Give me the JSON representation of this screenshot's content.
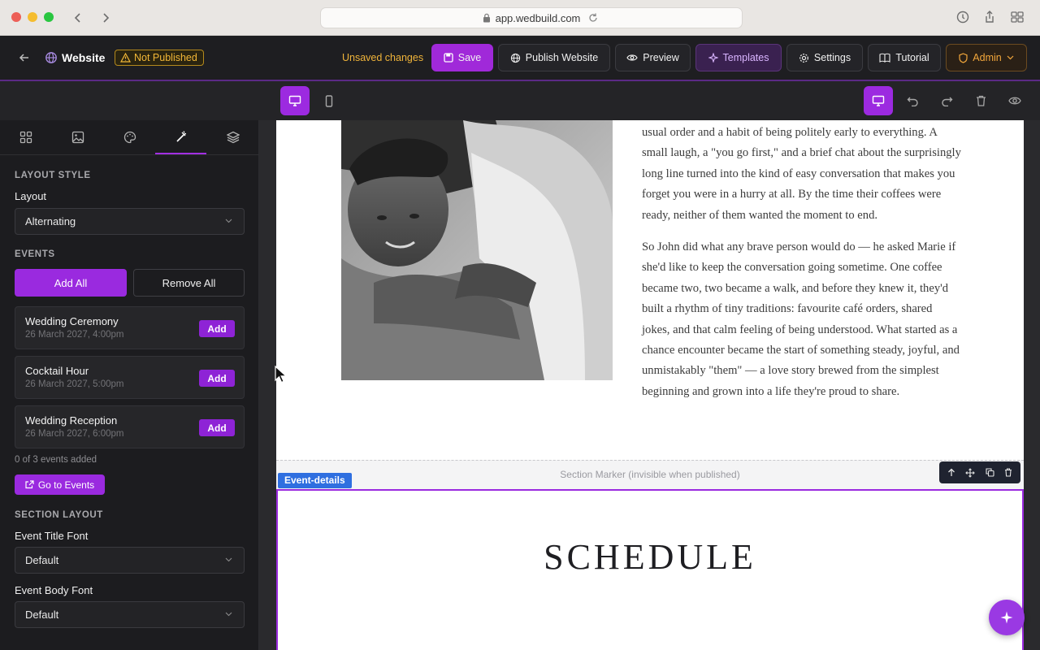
{
  "browser": {
    "url": "app.wedbuild.com"
  },
  "header": {
    "site_title": "Website",
    "status_badge": "Not Published",
    "unsaved_text": "Unsaved changes",
    "save_label": "Save",
    "publish_label": "Publish Website",
    "preview_label": "Preview",
    "templates_label": "Templates",
    "settings_label": "Settings",
    "tutorial_label": "Tutorial",
    "admin_label": "Admin"
  },
  "panel": {
    "tabs": [
      "grid-icon",
      "image-icon",
      "palette-icon",
      "wand-icon",
      "layers-icon"
    ],
    "active_tab": 3,
    "layout_style_heading": "LAYOUT STYLE",
    "layout_label": "Layout",
    "layout_value": "Alternating",
    "events_heading": "EVENTS",
    "add_all_label": "Add All",
    "remove_all_label": "Remove All",
    "events": [
      {
        "title": "Wedding Ceremony",
        "date": "26 March 2027, 4:00pm",
        "action": "Add"
      },
      {
        "title": "Cocktail Hour",
        "date": "26 March 2027, 5:00pm",
        "action": "Add"
      },
      {
        "title": "Wedding Reception",
        "date": "26 March 2027, 6:00pm",
        "action": "Add"
      }
    ],
    "events_count": "0 of 3 events added",
    "goto_events_label": "Go to Events",
    "section_layout_heading": "SECTION LAYOUT",
    "title_font_label": "Event Title Font",
    "title_font_value": "Default",
    "body_font_label": "Event Body Font",
    "body_font_value": "Default"
  },
  "canvas": {
    "story_p1": "usual order and a habit of being politely early to everything. A small laugh, a \"you go first,\" and a brief chat about the surprisingly long line turned into the kind of easy conversation that makes you forget you were in a hurry at all. By the time their coffees were ready, neither of them wanted the moment to end.",
    "story_p2": "So John did what any brave person would do — he asked Marie if she'd like to keep the conversation going sometime. One coffee became two, two became a walk, and before they knew it, they'd built a rhythm of tiny traditions: favourite café orders, shared jokes, and that calm feeling of being understood. What started as a chance encounter became the start of something steady, joyful, and unmistakably \"them\" — a love story brewed from the simplest beginning and grown into a life they're proud to share.",
    "section_marker": "Section Marker (invisible when published)",
    "section_tag": "Event-details",
    "schedule_heading": "SCHEDULE"
  },
  "colors": {
    "accent": "#9a2adf",
    "warning": "#f2b737",
    "tag_blue": "#2f6fe0"
  }
}
